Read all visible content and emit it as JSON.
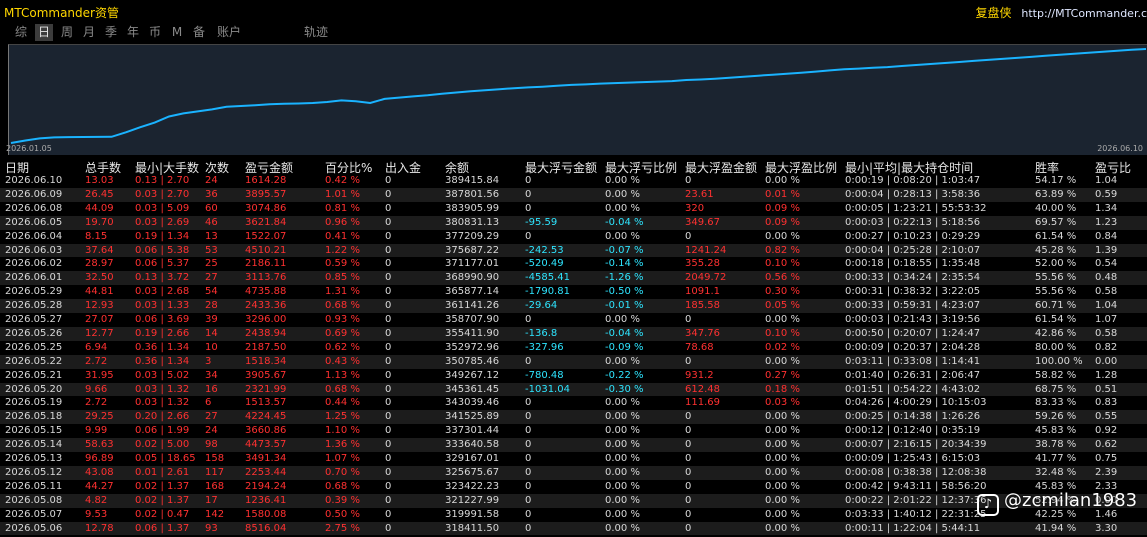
{
  "header": {
    "app_title": "MTCommander资管",
    "brand_name": "复盘侠",
    "brand_url": "http://MTCommander.c"
  },
  "tabs": [
    {
      "label": "综",
      "active": false
    },
    {
      "label": "日",
      "active": true
    },
    {
      "label": "周",
      "active": false
    },
    {
      "label": "月",
      "active": false
    },
    {
      "label": "季",
      "active": false
    },
    {
      "label": "年",
      "active": false
    },
    {
      "label": "币",
      "active": false
    },
    {
      "label": "M",
      "active": false
    },
    {
      "label": "备",
      "active": false
    },
    {
      "label": "账户",
      "active": false
    },
    {
      "label": "轨迹",
      "active": false
    }
  ],
  "chart": {
    "start_date": "2026.01.05",
    "end_date": "2026.06.10",
    "line_color": "#1ab3ff",
    "background": "#1b2430"
  },
  "chart_data": {
    "type": "line",
    "xlabel": "",
    "ylabel": "",
    "x_range": [
      "2026.01.05",
      "2026.06.10"
    ],
    "series": [
      {
        "values": [
          205000,
          210000,
          214000,
          216000,
          216500,
          216800,
          217000,
          217200,
          226000,
          236000,
          245000,
          257000,
          263000,
          267000,
          271000,
          276000,
          277500,
          279000,
          281000,
          282000,
          282500,
          283500,
          285500,
          288500,
          287000,
          283500,
          291500,
          294000,
          296500,
          298500,
          301500,
          304000,
          306500,
          308500,
          310500,
          312500,
          314000,
          315500,
          317500,
          319000,
          320000,
          321500,
          322500,
          323500,
          324500,
          325500,
          326500,
          328500,
          329500,
          331000,
          333000,
          335000,
          337000,
          339000,
          341000,
          343000,
          345000,
          347500,
          349500,
          351000,
          352500,
          354000,
          356000,
          358000,
          360000,
          362000,
          364000,
          366000,
          368000,
          370000,
          372000,
          374000,
          376000,
          378000,
          380000,
          382000,
          384000,
          386000,
          388000,
          389415.84
        ]
      }
    ]
  },
  "table": {
    "columns": [
      "日期",
      "总手数",
      "最小|大手数",
      "次数",
      "盈亏金额",
      "百分比%",
      "出入金",
      "余额",
      "最大浮亏金额",
      "最大浮亏比例",
      "最大浮盈金额",
      "最大浮盈比例",
      "最小|平均|最大持仓时间",
      "胜率",
      "盈亏比"
    ],
    "rows": [
      [
        "2026.06.10",
        "13.03",
        "0.13 | 2.70",
        "24",
        "1614.28",
        "0.42 %",
        "0",
        "389415.84",
        "0",
        "0.00 %",
        "0",
        "0.00 %",
        "0:00:19 | 0:08:20 | 1:03:47",
        "54.17 %",
        "1.04"
      ],
      [
        "2026.06.09",
        "26.45",
        "0.03 | 2.70",
        "36",
        "3895.57",
        "1.01 %",
        "0",
        "387801.56",
        "0",
        "0.00 %",
        "23.61",
        "0.01 %",
        "0:00:04 | 0:28:13 | 3:58:36",
        "63.89 %",
        "0.59"
      ],
      [
        "2026.06.08",
        "44.09",
        "0.03 | 5.09",
        "60",
        "3074.86",
        "0.81 %",
        "0",
        "383905.99",
        "0",
        "0.00 %",
        "320",
        "0.09 %",
        "0:00:05 | 1:23:21 | 55:53:32",
        "40.00 %",
        "1.34"
      ],
      [
        "2026.06.05",
        "19.70",
        "0.03 | 2.69",
        "46",
        "3621.84",
        "0.96 %",
        "0",
        "380831.13",
        "-95.59",
        "-0.04 %",
        "349.67",
        "0.09 %",
        "0:00:03 | 0:22:13 | 5:18:56",
        "69.57 %",
        "1.23"
      ],
      [
        "2026.06.04",
        "8.15",
        "0.19 | 1.34",
        "13",
        "1522.07",
        "0.41 %",
        "0",
        "377209.29",
        "0",
        "0.00 %",
        "0",
        "0.00 %",
        "0:00:27 | 0:10:23 | 0:29:29",
        "61.54 %",
        "0.84"
      ],
      [
        "2026.06.03",
        "37.64",
        "0.06 | 5.38",
        "53",
        "4510.21",
        "1.22 %",
        "0",
        "375687.22",
        "-242.53",
        "-0.07 %",
        "1241.24",
        "0.82 %",
        "0:00:04 | 0:25:28 | 2:10:07",
        "45.28 %",
        "1.39"
      ],
      [
        "2026.06.02",
        "28.97",
        "0.06 | 5.37",
        "25",
        "2186.11",
        "0.59 %",
        "0",
        "371177.01",
        "-520.49",
        "-0.14 %",
        "355.28",
        "0.10 %",
        "0:00:18 | 0:18:55 | 1:35:48",
        "52.00 %",
        "0.54"
      ],
      [
        "2026.06.01",
        "32.50",
        "0.13 | 3.72",
        "27",
        "3113.76",
        "0.85 %",
        "0",
        "368990.90",
        "-4585.41",
        "-1.26 %",
        "2049.72",
        "0.56 %",
        "0:00:33 | 0:34:24 | 2:35:54",
        "55.56 %",
        "0.48"
      ],
      [
        "2026.05.29",
        "44.81",
        "0.03 | 2.68",
        "54",
        "4735.88",
        "1.31 %",
        "0",
        "365877.14",
        "-1790.81",
        "-0.50 %",
        "1091.1",
        "0.30 %",
        "0:00:31 | 0:38:32 | 3:22:05",
        "55.56 %",
        "0.58"
      ],
      [
        "2026.05.28",
        "12.93",
        "0.03 | 1.33",
        "28",
        "2433.36",
        "0.68 %",
        "0",
        "361141.26",
        "-29.64",
        "-0.01 %",
        "185.58",
        "0.05 %",
        "0:00:33 | 0:59:31 | 4:23:07",
        "60.71 %",
        "1.04"
      ],
      [
        "2026.05.27",
        "27.07",
        "0.06 | 3.69",
        "39",
        "3296.00",
        "0.93 %",
        "0",
        "358707.90",
        "0",
        "0.00 %",
        "0",
        "0.00 %",
        "0:00:03 | 0:21:43 | 3:19:56",
        "61.54 %",
        "1.07"
      ],
      [
        "2026.05.26",
        "12.77",
        "0.19 | 2.66",
        "14",
        "2438.94",
        "0.69 %",
        "0",
        "355411.90",
        "-136.8",
        "-0.04 %",
        "347.76",
        "0.10 %",
        "0:00:50 | 0:20:07 | 1:24:47",
        "42.86 %",
        "0.58"
      ],
      [
        "2026.05.25",
        "6.94",
        "0.36 | 1.34",
        "10",
        "2187.50",
        "0.62 %",
        "0",
        "352972.96",
        "-327.96",
        "-0.09 %",
        "78.68",
        "0.02 %",
        "0:00:09 | 0:20:37 | 2:04:28",
        "80.00 %",
        "0.82"
      ],
      [
        "2026.05.22",
        "2.72",
        "0.36 | 1.34",
        "3",
        "1518.34",
        "0.43 %",
        "0",
        "350785.46",
        "0",
        "0.00 %",
        "0",
        "0.00 %",
        "0:03:11 | 0:33:08 | 1:14:41",
        "100.00 %",
        "0.00"
      ],
      [
        "2026.05.21",
        "31.95",
        "0.03 | 5.02",
        "34",
        "3905.67",
        "1.13 %",
        "0",
        "349267.12",
        "-780.48",
        "-0.22 %",
        "931.2",
        "0.27 %",
        "0:01:40 | 0:26:31 | 2:06:47",
        "58.82 %",
        "1.28"
      ],
      [
        "2026.05.20",
        "9.66",
        "0.03 | 1.32",
        "16",
        "2321.99",
        "0.68 %",
        "0",
        "345361.45",
        "-1031.04",
        "-0.30 %",
        "612.48",
        "0.18 %",
        "0:01:51 | 0:54:22 | 4:43:02",
        "68.75 %",
        "0.51"
      ],
      [
        "2026.05.19",
        "2.72",
        "0.03 | 1.32",
        "6",
        "1513.57",
        "0.44 %",
        "0",
        "343039.46",
        "0",
        "0.00 %",
        "111.69",
        "0.03 %",
        "0:04:26 | 4:00:29 | 10:15:03",
        "83.33 %",
        "0.83"
      ],
      [
        "2026.05.18",
        "29.25",
        "0.20 | 2.66",
        "27",
        "4224.45",
        "1.25 %",
        "0",
        "341525.89",
        "0",
        "0.00 %",
        "0",
        "0.00 %",
        "0:00:25 | 0:14:38 | 1:26:26",
        "59.26 %",
        "0.55"
      ],
      [
        "2026.05.15",
        "9.99",
        "0.06 | 1.99",
        "24",
        "3660.86",
        "1.10 %",
        "0",
        "337301.44",
        "0",
        "0.00 %",
        "0",
        "0.00 %",
        "0:00:12 | 0:12:40 | 0:35:19",
        "45.83 %",
        "0.92"
      ],
      [
        "2026.05.14",
        "58.63",
        "0.02 | 5.00",
        "98",
        "4473.57",
        "1.36 %",
        "0",
        "333640.58",
        "0",
        "0.00 %",
        "0",
        "0.00 %",
        "0:00:07 | 2:16:15 | 20:34:39",
        "38.78 %",
        "0.62"
      ],
      [
        "2026.05.13",
        "96.89",
        "0.05 | 18.65",
        "158",
        "3491.34",
        "1.07 %",
        "0",
        "329167.01",
        "0",
        "0.00 %",
        "0",
        "0.00 %",
        "0:00:09 | 1:25:43 | 6:15:03",
        "41.77 %",
        "0.75"
      ],
      [
        "2026.05.12",
        "43.08",
        "0.01 | 2.61",
        "117",
        "2253.44",
        "0.70 %",
        "0",
        "325675.67",
        "0",
        "0.00 %",
        "0",
        "0.00 %",
        "0:00:08 | 0:38:38 | 12:08:38",
        "32.48 %",
        "2.39"
      ],
      [
        "2026.05.11",
        "44.27",
        "0.02 | 1.37",
        "168",
        "2194.24",
        "0.68 %",
        "0",
        "323422.23",
        "0",
        "0.00 %",
        "0",
        "0.00 %",
        "0:00:42 | 9:43:11 | 58:56:20",
        "45.83 %",
        "2.33"
      ],
      [
        "2026.05.08",
        "4.82",
        "0.02 | 1.37",
        "17",
        "1236.41",
        "0.39 %",
        "0",
        "321227.99",
        "0",
        "0.00 %",
        "0",
        "0.00 %",
        "0:00:22 | 2:01:22 | 12:37:36",
        "52.94 %",
        "0.00"
      ],
      [
        "2026.05.07",
        "9.53",
        "0.02 | 0.47",
        "142",
        "1580.08",
        "0.50 %",
        "0",
        "319991.58",
        "0",
        "0.00 %",
        "0",
        "0.00 %",
        "0:03:33 | 1:40:12 | 22:31:25",
        "42.25 %",
        "1.46"
      ],
      [
        "2026.05.06",
        "12.78",
        "0.06 | 1.37",
        "93",
        "8516.04",
        "2.75 %",
        "0",
        "318411.50",
        "0",
        "0.00 %",
        "0",
        "0.00 %",
        "0:00:11 | 1:22:04 | 5:44:11",
        "41.94 %",
        "3.30"
      ]
    ]
  },
  "watermark": {
    "icon": "douyin-icon",
    "text": "@zcmilan1983"
  }
}
